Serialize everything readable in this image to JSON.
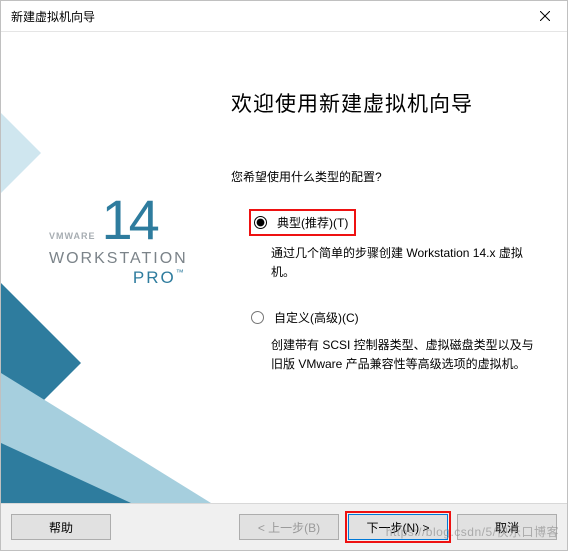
{
  "titlebar": {
    "title": "新建虚拟机向导"
  },
  "brand": {
    "vmware": "VMWARE",
    "number": "14",
    "workstation": "WORKSTATION",
    "pro": "PRO",
    "tm": "™"
  },
  "content": {
    "heading": "欢迎使用新建虚拟机向导",
    "question": "您希望使用什么类型的配置?",
    "options": {
      "typical": {
        "label": "典型(推荐)(T)",
        "desc": "通过几个简单的步骤创建 Workstation 14.x 虚拟机。"
      },
      "custom": {
        "label": "自定义(高级)(C)",
        "desc": "创建带有 SCSI 控制器类型、虚拟磁盘类型以及与旧版 VMware 产品兼容性等高级选项的虚拟机。"
      }
    }
  },
  "footer": {
    "help": "帮助",
    "back": "< 上一步(B)",
    "next": "下一步(N) >",
    "cancel": "取消"
  },
  "watermark": "https://blog.csdn/5/快乐口博客"
}
